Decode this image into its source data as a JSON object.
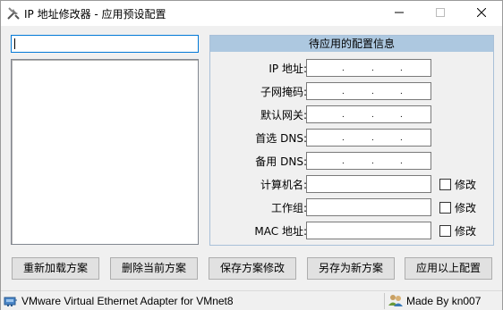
{
  "window": {
    "title": "IP 地址修改器 - 应用预设配置",
    "app_icon": "tools-icon"
  },
  "left_panel": {
    "scheme_name_value": "",
    "scheme_list_items": []
  },
  "config": {
    "header": "待应用的配置信息",
    "rows": [
      {
        "label": "IP 地址:",
        "type": "ip",
        "value": "",
        "checkbox": null
      },
      {
        "label": "子网掩码:",
        "type": "ip",
        "value": "",
        "checkbox": null
      },
      {
        "label": "默认网关:",
        "type": "ip",
        "value": "",
        "checkbox": null
      },
      {
        "label": "首选 DNS:",
        "type": "ip",
        "value": "",
        "checkbox": null
      },
      {
        "label": "备用 DNS:",
        "type": "ip",
        "value": "",
        "checkbox": null
      },
      {
        "label": "计算机名:",
        "type": "text",
        "value": "",
        "checkbox": "修改"
      },
      {
        "label": "工作组:",
        "type": "text",
        "value": "",
        "checkbox": "修改"
      },
      {
        "label": "MAC 地址:",
        "type": "text",
        "value": "",
        "checkbox": "修改"
      }
    ]
  },
  "buttons": {
    "reload": "重新加载方案",
    "delete": "删除当前方案",
    "save": "保存方案修改",
    "save_as": "另存为新方案",
    "apply": "应用以上配置"
  },
  "status": {
    "adapter": "VMware Virtual Ethernet Adapter for VMnet8",
    "adapter_icon": "network-adapter-icon",
    "credit": "Made By kn007",
    "credit_icon": "users-icon"
  }
}
